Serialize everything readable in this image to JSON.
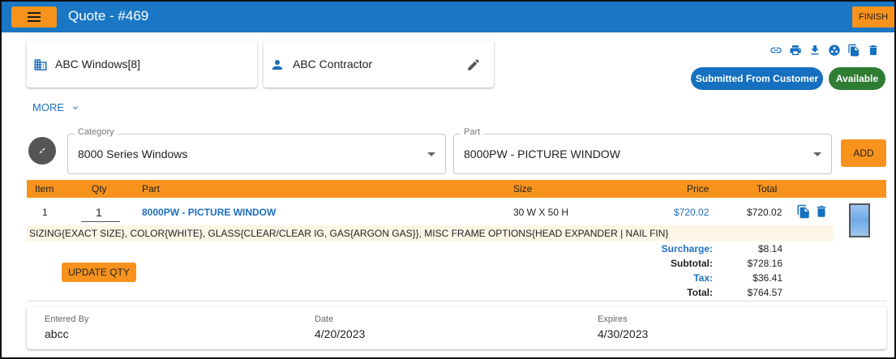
{
  "header": {
    "title": "Quote - #469",
    "finish_label": "FINISH"
  },
  "cards": {
    "company": "ABC Windows[8]",
    "contractor": "ABC Contractor"
  },
  "actions": [
    "link-icon",
    "print-icon",
    "download-icon",
    "share-icon",
    "copy-icon",
    "delete-icon"
  ],
  "status": {
    "submitted": "Submitted From Customer",
    "available": "Available"
  },
  "more_label": "MORE",
  "selector": {
    "category_label": "Category",
    "category_value": "8000 Series Windows",
    "part_label": "Part",
    "part_value": "8000PW - PICTURE WINDOW",
    "add_label": "ADD"
  },
  "table": {
    "headers": {
      "item": "Item",
      "qty": "Qty",
      "part": "Part",
      "size": "Size",
      "price": "Price",
      "total": "Total"
    },
    "row": {
      "item": "1",
      "qty": "1",
      "part": "8000PW - PICTURE WINDOW",
      "size": "30 W X 50 H",
      "price": "$720.02",
      "total": "$720.02",
      "options": "SIZING{EXACT SIZE}, COLOR{WHITE}, GLASS{CLEAR/CLEAR IG, GAS{ARGON GAS}}, MISC FRAME OPTIONS{HEAD EXPANDER | NAIL FIN}"
    }
  },
  "update_qty_label": "UPDATE QTY",
  "summary": {
    "surcharge_label": "Surcharge:",
    "surcharge": "$8.14",
    "subtotal_label": "Subtotal:",
    "subtotal": "$728.16",
    "tax_label": "Tax:",
    "tax": "$36.41",
    "total_label": "Total:",
    "total": "$764.57"
  },
  "meta": {
    "entered_by_label": "Entered By",
    "entered_by": "abcc",
    "date_label": "Date",
    "date": "4/20/2023",
    "expires_label": "Expires",
    "expires": "4/30/2023"
  },
  "colors": {
    "primary": "#1977c5",
    "accent": "#f7931d",
    "success": "#2e7d32",
    "link": "#1f6fbf"
  }
}
